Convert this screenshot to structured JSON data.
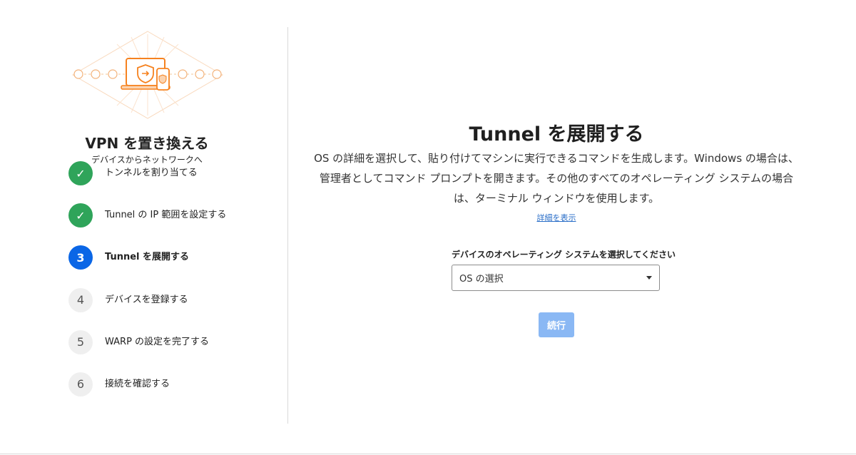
{
  "sidebar": {
    "title": "VPN を置き換える",
    "subtitle": "デバイスからネットワークへ",
    "steps": [
      {
        "marker": "✓",
        "label": "トンネルを割り当てる",
        "state": "done"
      },
      {
        "marker": "✓",
        "label": "Tunnel の IP 範囲を設定する",
        "state": "done"
      },
      {
        "marker": "3",
        "label": "Tunnel を展開する",
        "state": "active"
      },
      {
        "marker": "4",
        "label": "デバイスを登録する",
        "state": "todo"
      },
      {
        "marker": "5",
        "label": "WARP の設定を完了する",
        "state": "todo"
      },
      {
        "marker": "6",
        "label": "接続を確認する",
        "state": "todo"
      }
    ]
  },
  "main": {
    "title": "Tunnel を展開する",
    "description": "OS の詳細を選択して、貼り付けてマシンに実行できるコマンドを生成します。Windows の場合は、管理者としてコマンド プロンプトを開きます。その他のすべてのオペレーティング システムの場合は、ターミナル ウィンドウを使用します。",
    "details_link": "詳細を表示",
    "os_label": "デバイスのオペレーティング システムを選択してください",
    "os_select_value": "OS の選択",
    "continue_label": "続行"
  },
  "colors": {
    "done": "#2fa45a",
    "active": "#0a66e6",
    "todo": "#efefef",
    "accent": "#f6821f",
    "button_disabled": "#8ab8f4",
    "link": "#2a6ec8"
  },
  "icons": [
    "hero-illustration",
    "checkmark-icon",
    "dropdown-caret-icon"
  ]
}
